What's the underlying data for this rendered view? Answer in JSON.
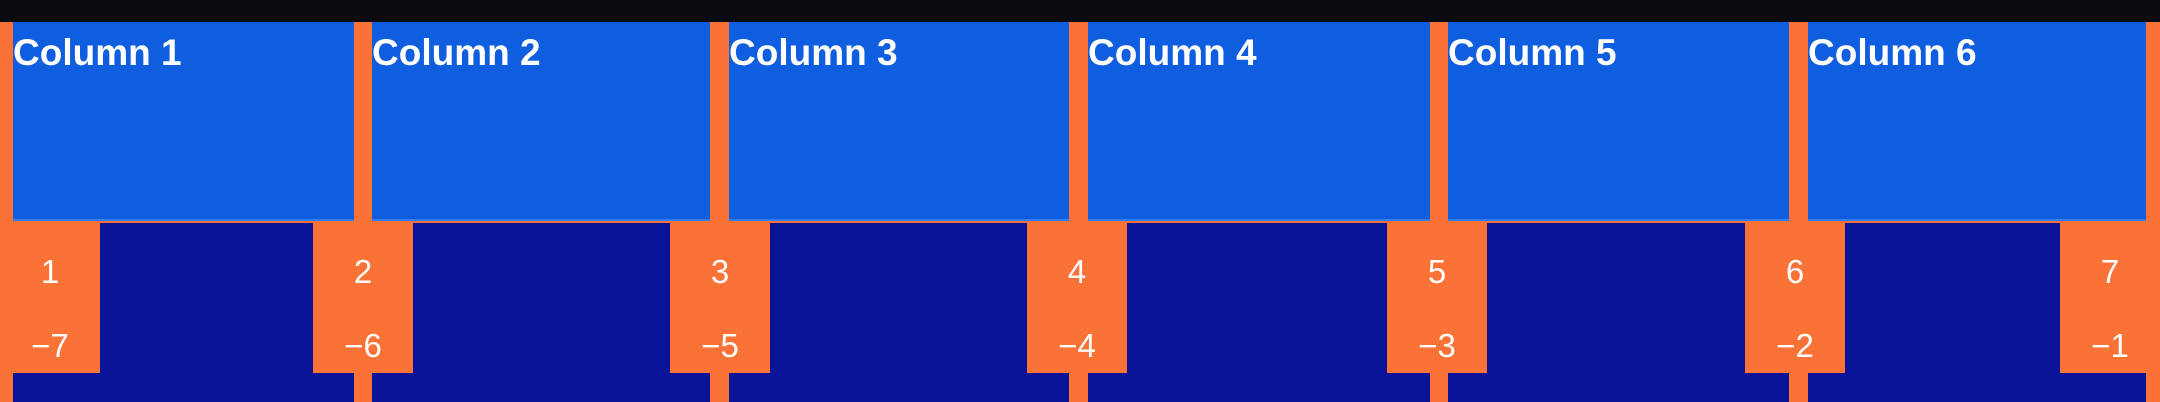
{
  "colors": {
    "background": "#0a0b0f",
    "gap": "#fb7236",
    "header": "#105ee0",
    "body": "#0a1498",
    "text": "#ffffff"
  },
  "columns": [
    {
      "label": "Column 1"
    },
    {
      "label": "Column 2"
    },
    {
      "label": "Column 3"
    },
    {
      "label": "Column 4"
    },
    {
      "label": "Column 5"
    },
    {
      "label": "Column 6"
    }
  ],
  "grid_lines": [
    {
      "positive": "1",
      "negative": "−7"
    },
    {
      "positive": "2",
      "negative": "−6"
    },
    {
      "positive": "3",
      "negative": "−5"
    },
    {
      "positive": "4",
      "negative": "−4"
    },
    {
      "positive": "5",
      "negative": "−3"
    },
    {
      "positive": "6",
      "negative": "−2"
    },
    {
      "positive": "7",
      "negative": "−1"
    }
  ]
}
